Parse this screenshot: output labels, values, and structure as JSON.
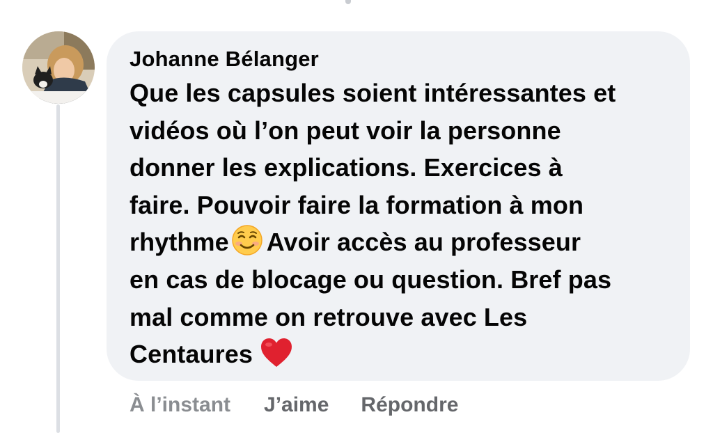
{
  "comment": {
    "author": "Johanne Bélanger",
    "lines": [
      "Que les capsules soient intéressantes et",
      "vidéos où l’on peut voir la personne",
      "donner les explications. Exercices à",
      "faire. Pouvoir faire la formation à mon",
      "rhythme",
      "Avoir accès au professeur",
      "en cas de blocage ou question. Bref pas",
      "mal comme on retrouve avec Les",
      "Centaures"
    ],
    "emojis": [
      "smiling-face-emoji",
      "red-heart-emoji"
    ]
  },
  "actions": {
    "timestamp": "À l’instant",
    "like_label": "J’aime",
    "reply_label": "Répondre"
  },
  "colors": {
    "bubble_background": "#f0f2f5",
    "text": "#050505",
    "action_text": "#65676b",
    "heart": "#e0212f"
  }
}
